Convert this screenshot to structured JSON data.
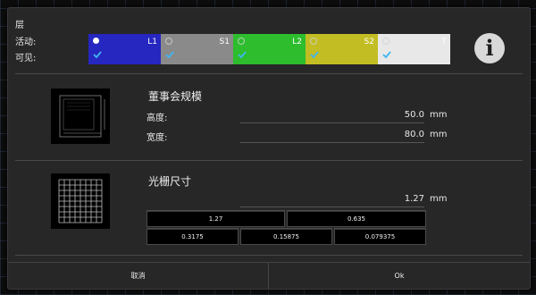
{
  "dialog": {
    "layers_label": "层",
    "active_label": "活动:",
    "visible_label": "可见:",
    "layers": [
      {
        "name": "L1",
        "color": "#2626c0",
        "text_color": "#ffffff",
        "active": true,
        "visible": true
      },
      {
        "name": "S1",
        "color": "#8a8a8a",
        "text_color": "#ffffff",
        "active": false,
        "visible": true
      },
      {
        "name": "L2",
        "color": "#2dbd2d",
        "text_color": "#ffffff",
        "active": false,
        "visible": true
      },
      {
        "name": "S2",
        "color": "#c2bd22",
        "text_color": "#ffffff",
        "active": false,
        "visible": true
      },
      {
        "name": "T",
        "color": "#e8e8e8",
        "text_color": "#ffffff",
        "active": false,
        "visible": true
      }
    ],
    "info_icon": "i",
    "board": {
      "title": "董事会规模",
      "height_label": "高度:",
      "height_value": "50.0",
      "height_unit": "mm",
      "width_label": "宽度:",
      "width_value": "80.0",
      "width_unit": "mm"
    },
    "grid": {
      "title": "光栅尺寸",
      "value": "1.27",
      "unit": "mm",
      "presets_row1": [
        "1.27",
        "0.635"
      ],
      "presets_row2": [
        "0.3175",
        "0.15875",
        "0.079375"
      ]
    },
    "cancel_label": "取消",
    "ok_label": "Ok"
  },
  "colors": {
    "check": "#3fb6f0",
    "panel": "#272727",
    "accent_info": "#d9d9d9"
  }
}
